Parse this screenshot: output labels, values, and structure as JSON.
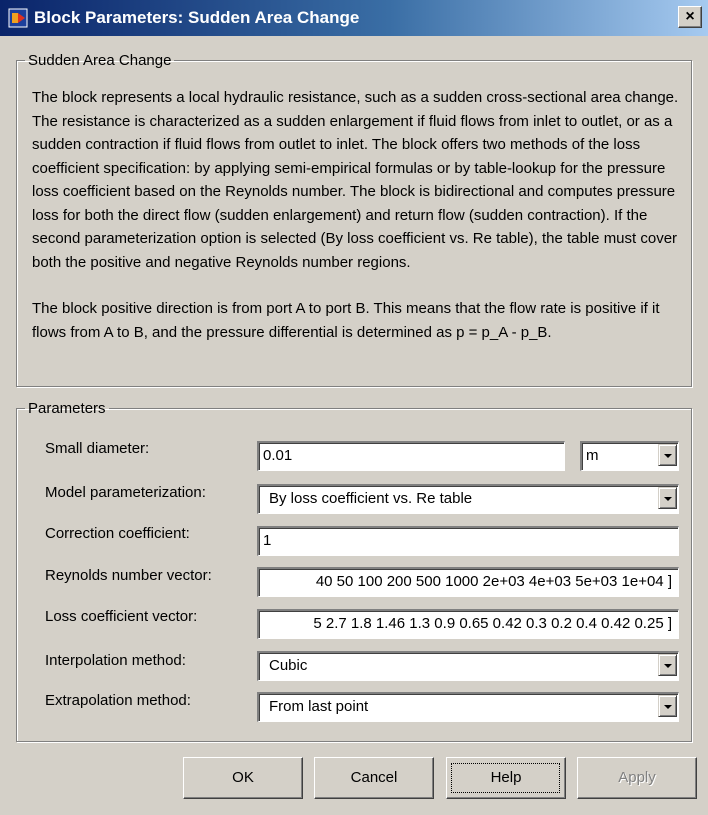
{
  "window": {
    "title": "Block Parameters: Sudden Area Change",
    "close_label": "×"
  },
  "description": {
    "group_label": "Sudden Area Change",
    "paragraph1": "The block represents a local hydraulic resistance, such as a sudden cross-sectional area change. The resistance is characterized as a sudden enlargement if fluid flows from inlet to outlet, or as a sudden contraction if fluid flows from outlet to inlet. The block offers two methods of the loss coefficient specification: by applying semi-empirical formulas or by table-lookup for the pressure loss coefficient based on the Reynolds number. The block is bidirectional and computes pressure loss for both the direct flow (sudden enlargement) and return flow (sudden contraction). If the second parameterization option is selected (By loss coefficient vs. Re table), the table must cover both the positive and negative Reynolds number regions.",
    "paragraph2": "The block positive direction is from port A to port B. This means that the flow rate is positive if it flows from A to B, and the pressure differential is determined as p = p_A - p_B."
  },
  "parameters": {
    "group_label": "Parameters",
    "small_diameter": {
      "label": "Small diameter:",
      "value": "0.01",
      "unit": "m"
    },
    "model_parameterization": {
      "label": "Model parameterization:",
      "value": "By loss coefficient vs. Re table"
    },
    "correction_coefficient": {
      "label": "Correction coefficient:",
      "value": "1"
    },
    "reynolds_vector": {
      "label": "Reynolds number vector:",
      "value": "40 50 100 200 500 1000 2e+03 4e+03 5e+03 1e+04 ]"
    },
    "loss_vector": {
      "label": "Loss coefficient vector:",
      "value": "5 2.7 1.8 1.46 1.3 0.9 0.65 0.42 0.3 0.2 0.4 0.42 0.25 ]"
    },
    "interpolation": {
      "label": "Interpolation method:",
      "value": "Cubic"
    },
    "extrapolation": {
      "label": "Extrapolation method:",
      "value": "From last point"
    }
  },
  "buttons": {
    "ok": "OK",
    "cancel": "Cancel",
    "help": "Help",
    "apply": "Apply"
  }
}
